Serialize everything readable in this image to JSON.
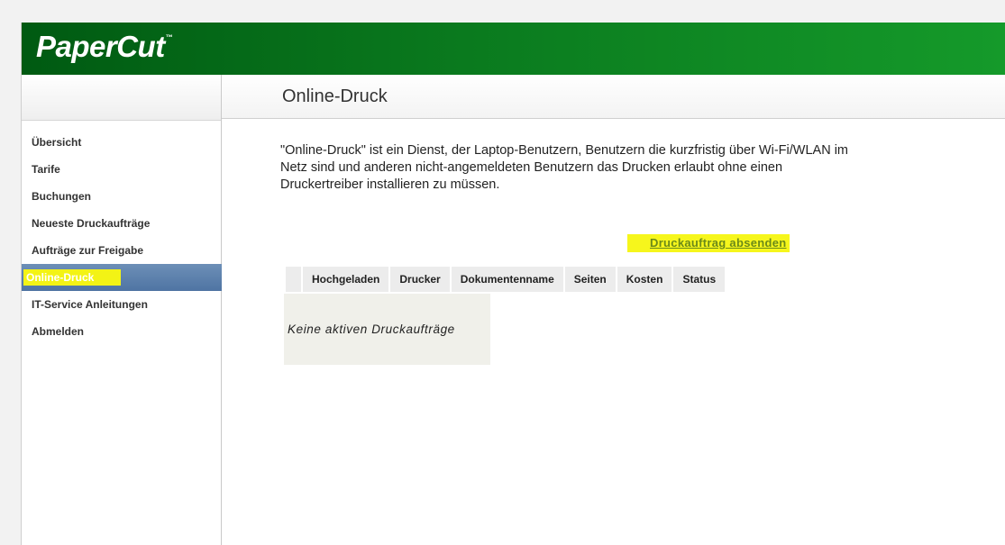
{
  "app": {
    "logo_text": "PaperCut",
    "logo_tm": "™"
  },
  "colors": {
    "header_green": "#0a7a1e",
    "active_nav": "#5a7fae",
    "highlight": "#f6f61c",
    "link": "#6b8a19"
  },
  "sidebar": {
    "items": [
      {
        "label": "Übersicht",
        "active": false
      },
      {
        "label": "Tarife",
        "active": false
      },
      {
        "label": "Buchungen",
        "active": false
      },
      {
        "label": "Neueste Druckaufträge",
        "active": false
      },
      {
        "label": "Aufträge zur Freigabe",
        "active": false
      },
      {
        "label": "Online-Druck",
        "active": true
      },
      {
        "label": "IT-Service Anleitungen",
        "active": false
      },
      {
        "label": "Abmelden",
        "active": false
      }
    ]
  },
  "main": {
    "title": "Online-Druck",
    "intro": "\"Online-Druck\" ist ein Dienst, der Laptop-Benutzern, Benutzern die kurzfristig über Wi-Fi/WLAN im Netz sind und anderen nicht-angemeldeten Benutzern das Drucken erlaubt ohne einen Druckertreiber installieren zu müssen.",
    "submit_link": "Druckauftrag absenden",
    "table": {
      "columns": [
        "",
        "Hochgeladen",
        "Drucker",
        "Dokumentenname",
        "Seiten",
        "Kosten",
        "Status"
      ],
      "empty_message": "Keine aktiven Druckaufträge"
    }
  }
}
